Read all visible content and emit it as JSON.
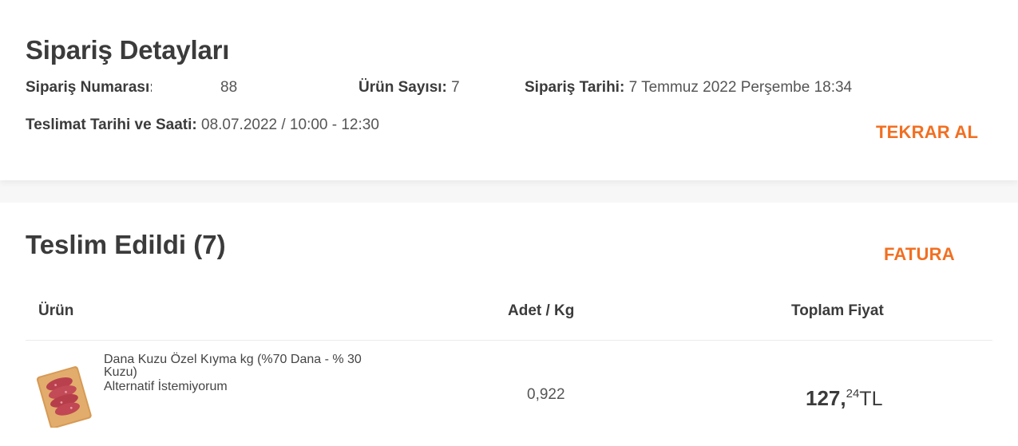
{
  "header": {
    "title": "Sipariş Detayları",
    "order_number_label": "Sipariş Numarası:",
    "order_number_value": "88",
    "item_count_label": "Ürün Sayısı:",
    "item_count_value": "7",
    "order_date_label": "Sipariş Tarihi:",
    "order_date_value": "7 Temmuz 2022 Perşembe 18:34",
    "delivery_label": "Teslimat Tarihi ve Saati:",
    "delivery_value": "08.07.2022 / 10:00 - 12:30",
    "reorder_button": "TEKRAR AL"
  },
  "delivered": {
    "title": "Teslim Edildi (7)",
    "invoice_button": "FATURA",
    "columns": {
      "product": "Ürün",
      "quantity": "Adet / Kg",
      "total": "Toplam Fiyat"
    },
    "items": [
      {
        "name": "Dana Kuzu Özel Kıyma kg (%70 Dana - % 30 Kuzu)",
        "note": "Alternatif İstemiyorum",
        "quantity": "0,922",
        "price_int": "127,",
        "price_dec": "24",
        "currency": "TL"
      }
    ]
  },
  "colors": {
    "accent": "#f26f21",
    "text": "#3b3b3b",
    "background": "#f7f7f7"
  }
}
